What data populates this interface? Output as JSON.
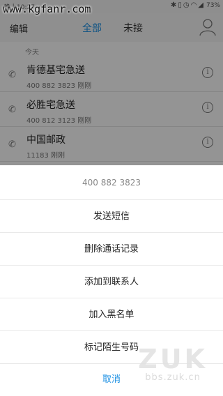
{
  "status_bar": {
    "time": "晚上10:27",
    "icons": [
      "bluetooth-icon",
      "vibrate-icon",
      "alarm-icon",
      "wifi-icon",
      "signal-icon"
    ],
    "battery": "73%"
  },
  "watermark_top": "www.kgfanr.com",
  "header": {
    "edit_label": "编辑",
    "tabs": [
      {
        "label": "全部",
        "active": true
      },
      {
        "label": "未接",
        "active": false
      }
    ]
  },
  "section_label": "今天",
  "calls": [
    {
      "name": "肯德基宅急送",
      "detail": "400 882 3823 刚刚"
    },
    {
      "name": "必胜宅急送",
      "detail": "400 812 3123 刚刚"
    },
    {
      "name": "中国邮政",
      "detail": "11183 刚刚"
    }
  ],
  "action_sheet": {
    "title": "400 882 3823",
    "items": [
      "发送短信",
      "删除通话记录",
      "添加到联系人",
      "加入黑名单",
      "标记陌生号码"
    ],
    "cancel": "取消"
  },
  "zuk_watermark": {
    "logo": "ZUK",
    "url": "bbs.zuk.cn"
  },
  "colors": {
    "accent": "#1a8fe3",
    "overlay": "rgba(0,0,0,0.42)"
  }
}
